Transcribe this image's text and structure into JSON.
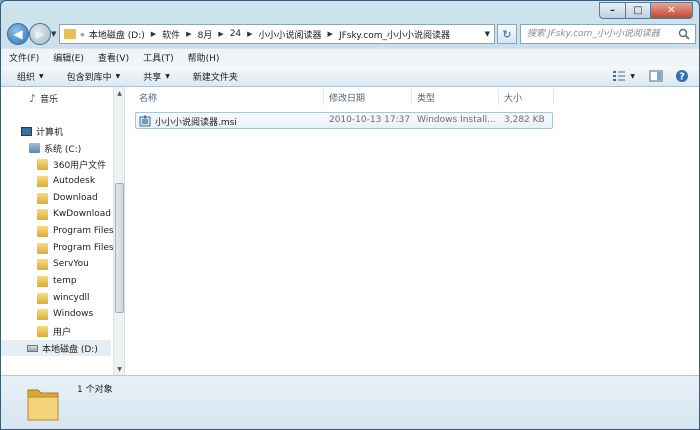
{
  "window": {
    "minimize": "–",
    "maximize": "□",
    "close": "✕"
  },
  "address_bar": {
    "overflow": "«",
    "crumbs": [
      "本地磁盘 (D:)",
      "软件",
      "8月",
      "24",
      "小小小说阅读器",
      "JFsky.com_小小小说阅读器"
    ]
  },
  "search": {
    "placeholder": "搜索 JFsky.com_小小小说阅读器"
  },
  "menu": [
    "文件(F)",
    "编辑(E)",
    "查看(V)",
    "工具(T)",
    "帮助(H)"
  ],
  "commands": {
    "organize": "组织",
    "include_in_library": "包含到库中",
    "share": "共享",
    "new_folder": "新建文件夹"
  },
  "nav_pane": {
    "music": "音乐",
    "computer": "计算机",
    "drive_c": "系统 (C:)",
    "folders": [
      "360用户文件",
      "Autodesk",
      "Download",
      "KwDownload",
      "Program Files",
      "Program Files",
      "ServYou",
      "temp",
      "wincydll",
      "Windows",
      "用户"
    ],
    "drive_d": "本地磁盘 (D:)"
  },
  "file_list": {
    "columns": [
      "名称",
      "修改日期",
      "类型",
      "大小"
    ],
    "rows": [
      {
        "name": "小小小说阅读器.msi",
        "modified": "2010-10-13 17:37",
        "type": "Windows Install...",
        "size": "3,282 KB"
      }
    ]
  },
  "details": {
    "count": "1 个对象"
  },
  "colors": {
    "chrome": "#b9d4e3",
    "folder": "#e7c05a",
    "selection_border": "#a9c5dc"
  }
}
